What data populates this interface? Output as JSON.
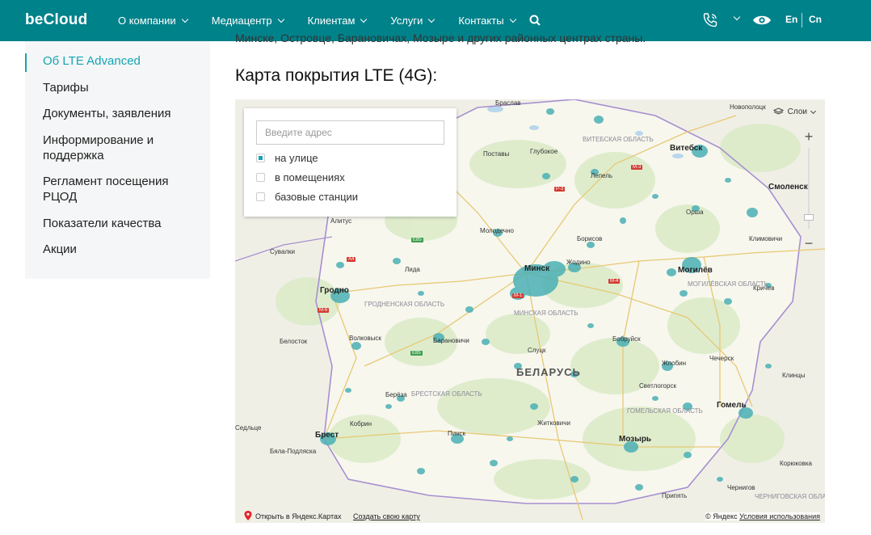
{
  "header": {
    "logo": "beCloud",
    "nav": [
      "О компании",
      "Медиацентр",
      "Клиентам",
      "Услуги",
      "Контакты"
    ],
    "lang_en": "En",
    "lang_cn": "Cn"
  },
  "sidebar": {
    "items": [
      {
        "label": "Об LTE Advanced",
        "active": true
      },
      {
        "label": "Тарифы"
      },
      {
        "label": "Документы, заявления"
      },
      {
        "label": "Информирование и поддержка"
      },
      {
        "label": "Регламент посещения РЦОД"
      },
      {
        "label": "Показатели качества"
      },
      {
        "label": "Акции"
      }
    ]
  },
  "content": {
    "cut_text": "Минске, Островце, Барановичах, Мозыре и других районных центрах страны.",
    "title": "Карта покрытия LTE (4G):"
  },
  "map": {
    "panel": {
      "placeholder": "Введите адрес",
      "options": [
        {
          "label": "на улице",
          "checked": true
        },
        {
          "label": "в помещениях",
          "checked": false
        },
        {
          "label": "базовые станции",
          "checked": false
        }
      ]
    },
    "layers_label": "Слои",
    "zoom_plus": "+",
    "zoom_minus": "−",
    "open_link": "Открыть в Яндекс.Картах",
    "create_link": "Создать свою карту",
    "copyright": "© Яндекс",
    "terms": "Условия использования",
    "country": "БЕЛАРУСЬ",
    "cities": [
      "Браслав",
      "Глубокое",
      "Поставы",
      "Витебск",
      "Лепель",
      "Новополоцк",
      "Смоленск",
      "Орша",
      "Молодечно",
      "Борисов",
      "Минск",
      "Жодино",
      "Могилёв",
      "Кричев",
      "Гродно",
      "Лида",
      "Волковыск",
      "Барановичи",
      "Слуцк",
      "Бобруйск",
      "Жлобин",
      "Чечерск",
      "Климовичи",
      "Светлогорск",
      "Гомель",
      "Берёза",
      "Кобрин",
      "Брест",
      "Пинск",
      "Житковичи",
      "Мозырь",
      "Сувалки",
      "Белосток",
      "Алитус",
      "Бяла-Подляска",
      "Седльце",
      "Чернигов",
      "Клинцы",
      "Корюковка",
      "Припять"
    ],
    "regions": [
      "Витебская область",
      "Минская область",
      "Гродненская область",
      "Могилёвская область",
      "Брестская область",
      "Гомельская область",
      "Черниговская область"
    ],
    "roads": [
      "E85",
      "A4",
      "M-6",
      "M-4",
      "M-1",
      "P-3",
      "M-3",
      "E85"
    ]
  },
  "colors": {
    "brand": "#00828a",
    "accent": "#14a4b4",
    "coverage": "#4bb0b5"
  }
}
